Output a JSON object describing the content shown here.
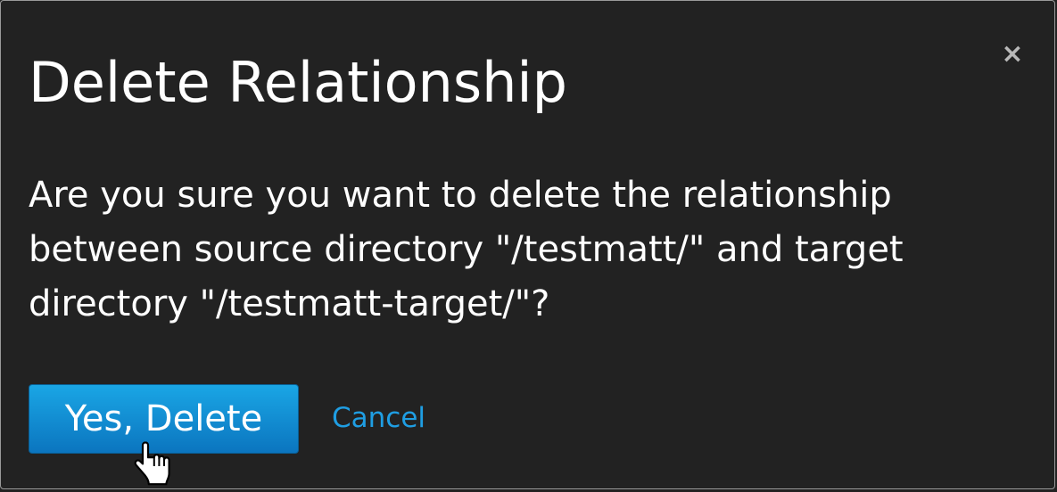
{
  "dialog": {
    "title": "Delete Relationship",
    "close_symbol": "×",
    "message_lines": [
      "Are you sure you want to delete the relationship",
      "between source directory \"/testmatt/\" and target",
      "directory \"/testmatt-target/\"?"
    ],
    "confirm_label": "Yes, Delete",
    "cancel_label": "Cancel"
  },
  "icons": {
    "close": "close-icon",
    "cursor": "hand-pointer-cursor-icon"
  },
  "colors": {
    "background": "#222222",
    "text": "#ffffff",
    "primary_button_top": "#1aa6e5",
    "primary_button_bottom": "#0b75bf",
    "link": "#1f9ee3",
    "close": "#b8b8b8"
  }
}
